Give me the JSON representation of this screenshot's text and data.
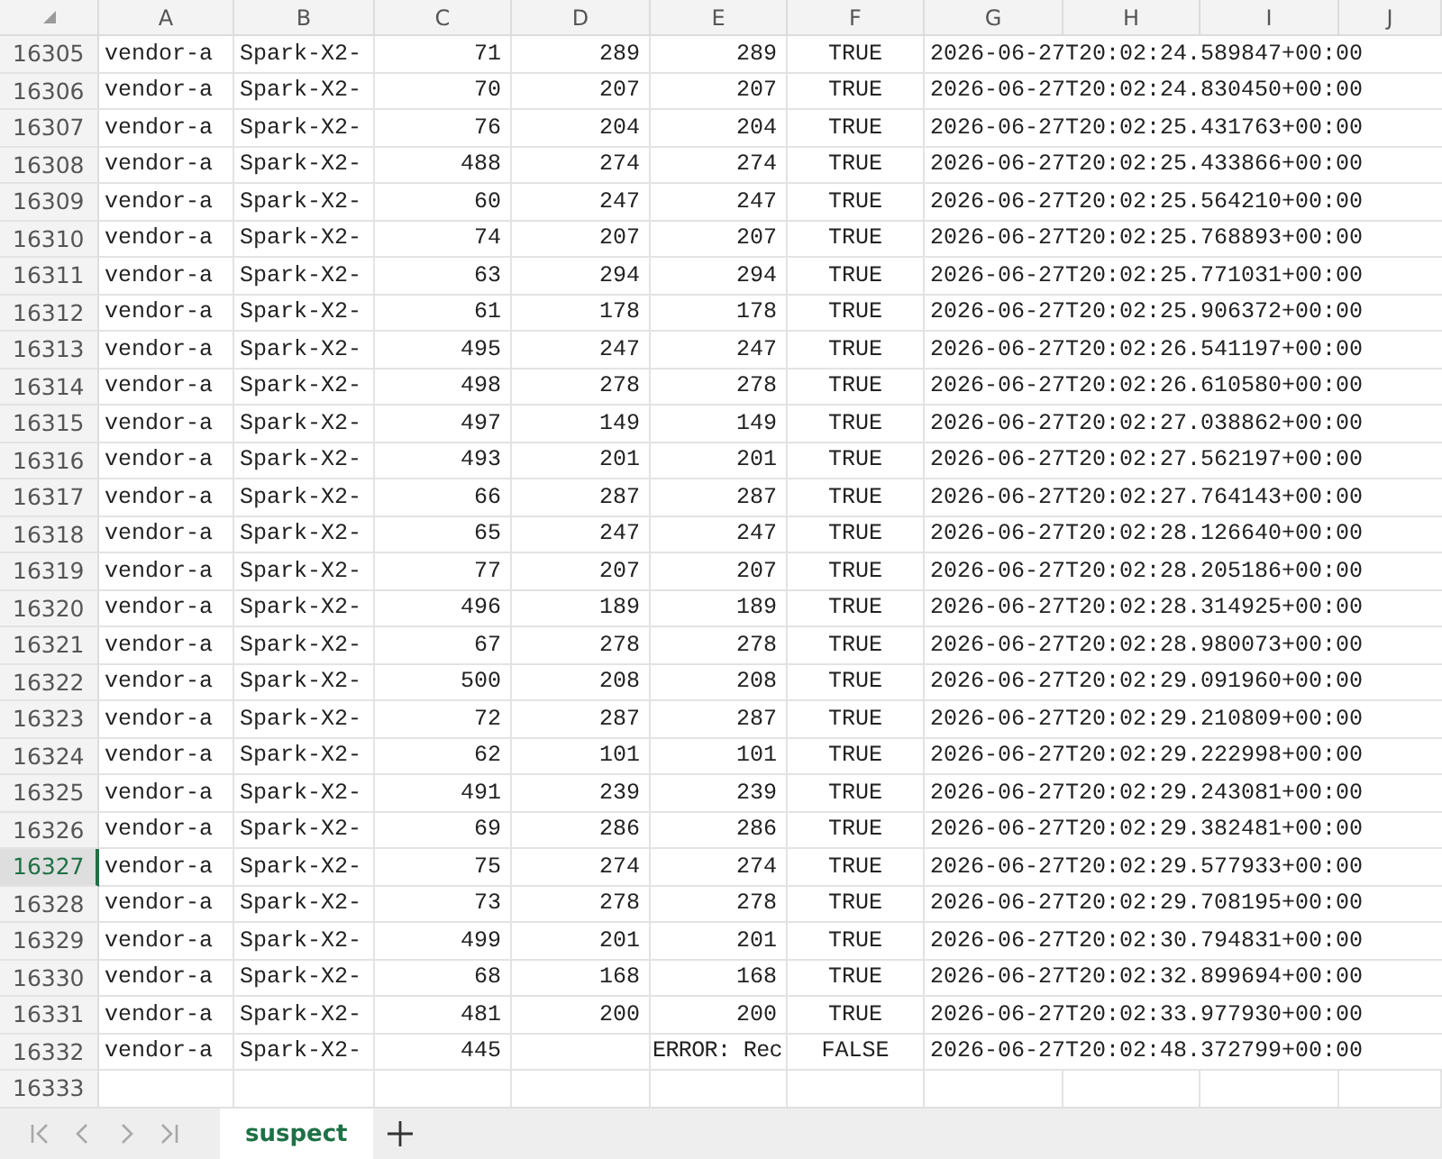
{
  "columns": [
    {
      "label": "A"
    },
    {
      "label": "B"
    },
    {
      "label": "C"
    },
    {
      "label": "D"
    },
    {
      "label": "E"
    },
    {
      "label": "F"
    },
    {
      "label": "G"
    },
    {
      "label": "H"
    },
    {
      "label": "I"
    },
    {
      "label": "J"
    }
  ],
  "rows": [
    {
      "header": "16305",
      "selected": false,
      "kind": "ok",
      "cells": [
        "vendor-a",
        "Spark-X2-",
        "71",
        "289",
        "289",
        "TRUE",
        "2026-06-27T20:02:24.589847+00:00"
      ]
    },
    {
      "header": "16306",
      "selected": false,
      "kind": "ok",
      "cells": [
        "vendor-a",
        "Spark-X2-",
        "70",
        "207",
        "207",
        "TRUE",
        "2026-06-27T20:02:24.830450+00:00"
      ]
    },
    {
      "header": "16307",
      "selected": false,
      "kind": "ok",
      "cells": [
        "vendor-a",
        "Spark-X2-",
        "76",
        "204",
        "204",
        "TRUE",
        "2026-06-27T20:02:25.431763+00:00"
      ]
    },
    {
      "header": "16308",
      "selected": false,
      "kind": "ok",
      "cells": [
        "vendor-a",
        "Spark-X2-",
        "488",
        "274",
        "274",
        "TRUE",
        "2026-06-27T20:02:25.433866+00:00"
      ]
    },
    {
      "header": "16309",
      "selected": false,
      "kind": "ok",
      "cells": [
        "vendor-a",
        "Spark-X2-",
        "60",
        "247",
        "247",
        "TRUE",
        "2026-06-27T20:02:25.564210+00:00"
      ]
    },
    {
      "header": "16310",
      "selected": false,
      "kind": "ok",
      "cells": [
        "vendor-a",
        "Spark-X2-",
        "74",
        "207",
        "207",
        "TRUE",
        "2026-06-27T20:02:25.768893+00:00"
      ]
    },
    {
      "header": "16311",
      "selected": false,
      "kind": "ok",
      "cells": [
        "vendor-a",
        "Spark-X2-",
        "63",
        "294",
        "294",
        "TRUE",
        "2026-06-27T20:02:25.771031+00:00"
      ]
    },
    {
      "header": "16312",
      "selected": false,
      "kind": "ok",
      "cells": [
        "vendor-a",
        "Spark-X2-",
        "61",
        "178",
        "178",
        "TRUE",
        "2026-06-27T20:02:25.906372+00:00"
      ]
    },
    {
      "header": "16313",
      "selected": false,
      "kind": "ok",
      "cells": [
        "vendor-a",
        "Spark-X2-",
        "495",
        "247",
        "247",
        "TRUE",
        "2026-06-27T20:02:26.541197+00:00"
      ]
    },
    {
      "header": "16314",
      "selected": false,
      "kind": "ok",
      "cells": [
        "vendor-a",
        "Spark-X2-",
        "498",
        "278",
        "278",
        "TRUE",
        "2026-06-27T20:02:26.610580+00:00"
      ]
    },
    {
      "header": "16315",
      "selected": false,
      "kind": "ok",
      "cells": [
        "vendor-a",
        "Spark-X2-",
        "497",
        "149",
        "149",
        "TRUE",
        "2026-06-27T20:02:27.038862+00:00"
      ]
    },
    {
      "header": "16316",
      "selected": false,
      "kind": "ok",
      "cells": [
        "vendor-a",
        "Spark-X2-",
        "493",
        "201",
        "201",
        "TRUE",
        "2026-06-27T20:02:27.562197+00:00"
      ]
    },
    {
      "header": "16317",
      "selected": false,
      "kind": "ok",
      "cells": [
        "vendor-a",
        "Spark-X2-",
        "66",
        "287",
        "287",
        "TRUE",
        "2026-06-27T20:02:27.764143+00:00"
      ]
    },
    {
      "header": "16318",
      "selected": false,
      "kind": "ok",
      "cells": [
        "vendor-a",
        "Spark-X2-",
        "65",
        "247",
        "247",
        "TRUE",
        "2026-06-27T20:02:28.126640+00:00"
      ]
    },
    {
      "header": "16319",
      "selected": false,
      "kind": "ok",
      "cells": [
        "vendor-a",
        "Spark-X2-",
        "77",
        "207",
        "207",
        "TRUE",
        "2026-06-27T20:02:28.205186+00:00"
      ]
    },
    {
      "header": "16320",
      "selected": false,
      "kind": "ok",
      "cells": [
        "vendor-a",
        "Spark-X2-",
        "496",
        "189",
        "189",
        "TRUE",
        "2026-06-27T20:02:28.314925+00:00"
      ]
    },
    {
      "header": "16321",
      "selected": false,
      "kind": "ok",
      "cells": [
        "vendor-a",
        "Spark-X2-",
        "67",
        "278",
        "278",
        "TRUE",
        "2026-06-27T20:02:28.980073+00:00"
      ]
    },
    {
      "header": "16322",
      "selected": false,
      "kind": "ok",
      "cells": [
        "vendor-a",
        "Spark-X2-",
        "500",
        "208",
        "208",
        "TRUE",
        "2026-06-27T20:02:29.091960+00:00"
      ]
    },
    {
      "header": "16323",
      "selected": false,
      "kind": "ok",
      "cells": [
        "vendor-a",
        "Spark-X2-",
        "72",
        "287",
        "287",
        "TRUE",
        "2026-06-27T20:02:29.210809+00:00"
      ]
    },
    {
      "header": "16324",
      "selected": false,
      "kind": "ok",
      "cells": [
        "vendor-a",
        "Spark-X2-",
        "62",
        "101",
        "101",
        "TRUE",
        "2026-06-27T20:02:29.222998+00:00"
      ]
    },
    {
      "header": "16325",
      "selected": false,
      "kind": "ok",
      "cells": [
        "vendor-a",
        "Spark-X2-",
        "491",
        "239",
        "239",
        "TRUE",
        "2026-06-27T20:02:29.243081+00:00"
      ]
    },
    {
      "header": "16326",
      "selected": false,
      "kind": "ok",
      "cells": [
        "vendor-a",
        "Spark-X2-",
        "69",
        "286",
        "286",
        "TRUE",
        "2026-06-27T20:02:29.382481+00:00"
      ]
    },
    {
      "header": "16327",
      "selected": true,
      "kind": "ok",
      "cells": [
        "vendor-a",
        "Spark-X2-",
        "75",
        "274",
        "274",
        "TRUE",
        "2026-06-27T20:02:29.577933+00:00"
      ]
    },
    {
      "header": "16328",
      "selected": false,
      "kind": "ok",
      "cells": [
        "vendor-a",
        "Spark-X2-",
        "73",
        "278",
        "278",
        "TRUE",
        "2026-06-27T20:02:29.708195+00:00"
      ]
    },
    {
      "header": "16329",
      "selected": false,
      "kind": "ok",
      "cells": [
        "vendor-a",
        "Spark-X2-",
        "499",
        "201",
        "201",
        "TRUE",
        "2026-06-27T20:02:30.794831+00:00"
      ]
    },
    {
      "header": "16330",
      "selected": false,
      "kind": "ok",
      "cells": [
        "vendor-a",
        "Spark-X2-",
        "68",
        "168",
        "168",
        "TRUE",
        "2026-06-27T20:02:32.899694+00:00"
      ]
    },
    {
      "header": "16331",
      "selected": false,
      "kind": "ok",
      "cells": [
        "vendor-a",
        "Spark-X2-",
        "481",
        "200",
        "200",
        "TRUE",
        "2026-06-27T20:02:33.977930+00:00"
      ]
    },
    {
      "header": "16332",
      "selected": false,
      "kind": "error",
      "cells": [
        "vendor-a",
        "Spark-X2-",
        "445",
        null,
        "ERROR: Rec",
        "FALSE",
        "2026-06-27T20:02:48.372799+00:00"
      ]
    },
    {
      "header": "16333",
      "selected": false,
      "cells": []
    }
  ],
  "sheet_tabs": [
    {
      "label": "suspect",
      "selected": true
    }
  ]
}
